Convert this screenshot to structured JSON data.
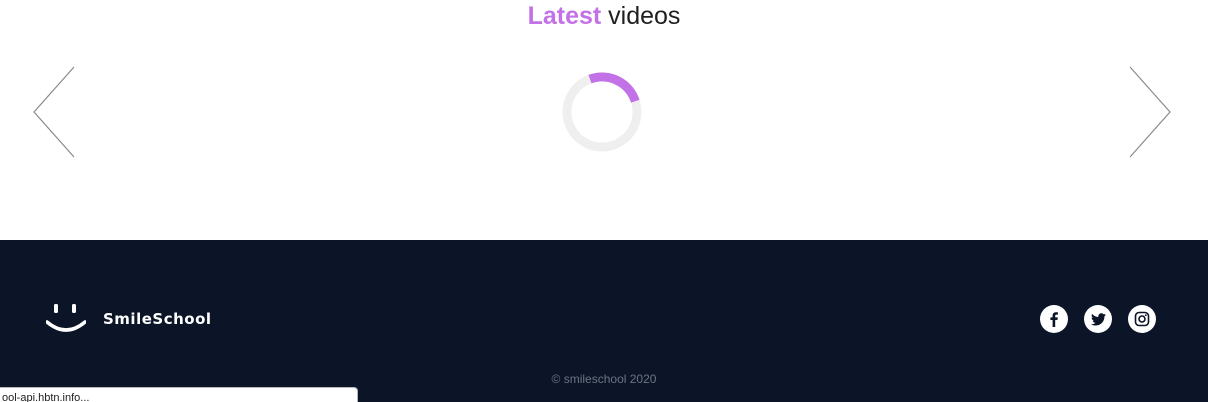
{
  "videos": {
    "title_accent": "Latest",
    "title_rest": " videos",
    "accent_color": "#c271e6",
    "prev_icon": "chevron-left-icon",
    "next_icon": "chevron-right-icon",
    "loading_icon": "spinner-icon"
  },
  "footer": {
    "background_color": "#0b1527",
    "logo_icon": "smiley-icon",
    "logo_text": "SmileSchool",
    "social": [
      {
        "icon": "facebook-icon"
      },
      {
        "icon": "twitter-icon"
      },
      {
        "icon": "instagram-icon"
      }
    ],
    "copyright": "© smileschool 2020"
  },
  "status_bar": {
    "text": "ool-api.hbtn.info..."
  }
}
